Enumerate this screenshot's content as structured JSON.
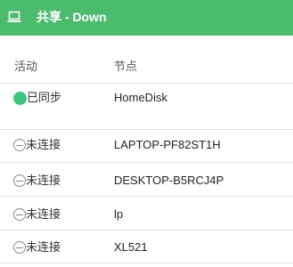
{
  "header": {
    "title": "共享 - Down",
    "icon": "laptop-icon",
    "background_color": "#4cbb6e"
  },
  "table": {
    "columns": {
      "activity": "活动",
      "node": "节点"
    },
    "rows": [
      {
        "status": "已同步",
        "status_icon": "synced-dot-icon",
        "status_color": "#3dc47e",
        "node": "HomeDisk"
      },
      {
        "status": "未连接",
        "status_icon": "disconnected-icon",
        "node": "LAPTOP-PF82ST1H"
      },
      {
        "status": "未连接",
        "status_icon": "disconnected-icon",
        "node": "DESKTOP-B5RCJ4P"
      },
      {
        "status": "未连接",
        "status_icon": "disconnected-icon",
        "node": "lp"
      },
      {
        "status": "未连接",
        "status_icon": "disconnected-icon",
        "node": "XL521"
      }
    ]
  }
}
